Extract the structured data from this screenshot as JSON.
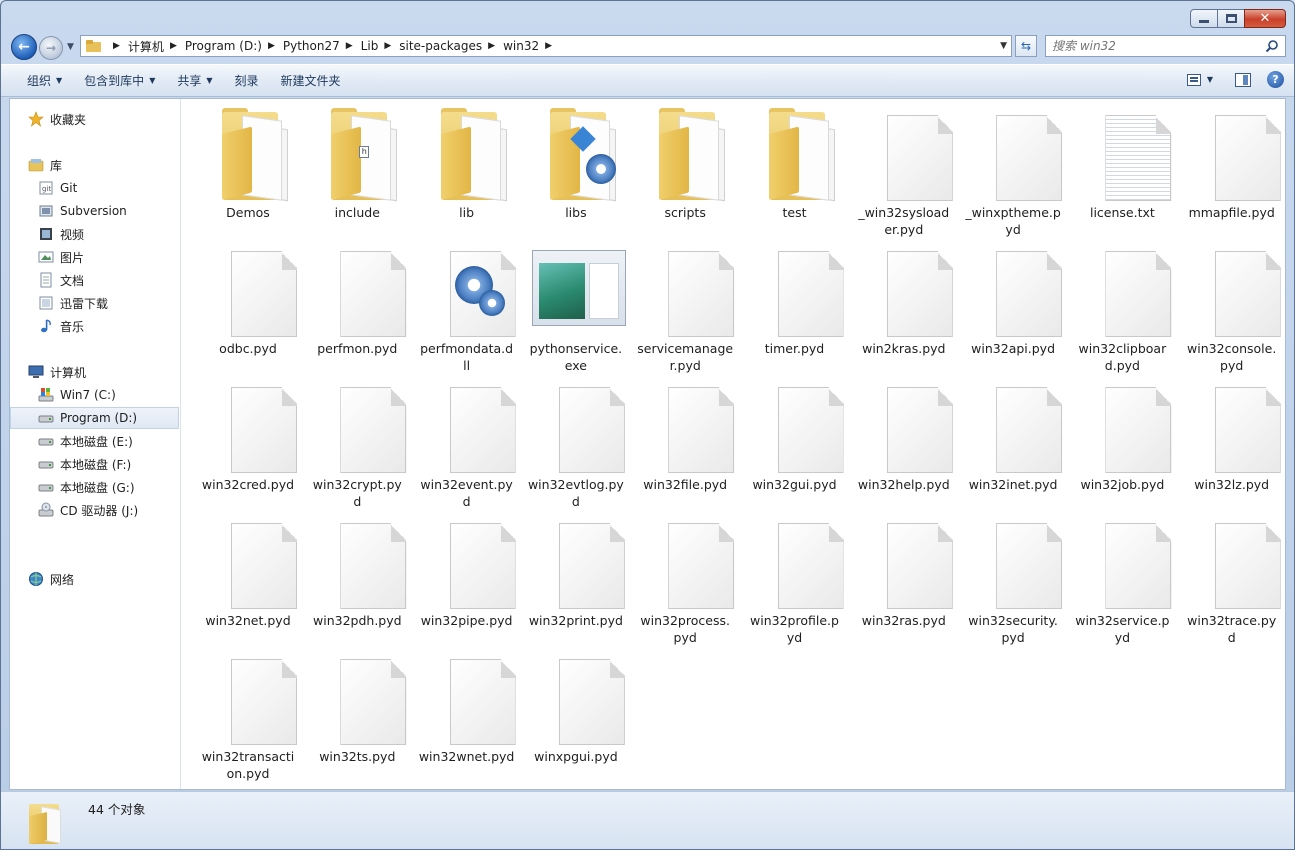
{
  "window": {
    "caption": {
      "minimize": "",
      "maximize": "",
      "close": "✕"
    }
  },
  "nav": {
    "breadcrumbs": [
      "计算机",
      "Program (D:)",
      "Python27",
      "Lib",
      "site-packages",
      "win32"
    ],
    "search_placeholder": "搜索 win32"
  },
  "toolbar": {
    "organize": "组织",
    "include_in_library": "包含到库中",
    "share": "共享",
    "burn": "刻录",
    "new_folder": "新建文件夹"
  },
  "sidebar": {
    "favorites": "收藏夹",
    "libraries": "库",
    "library_items": [
      "Git",
      "Subversion",
      "视频",
      "图片",
      "文档",
      "迅雷下载",
      "音乐"
    ],
    "computer": "计算机",
    "drives": [
      "Win7 (C:)",
      "Program (D:)",
      "本地磁盘 (E:)",
      "本地磁盘 (F:)",
      "本地磁盘 (G:)",
      "CD 驱动器 (J:)"
    ],
    "selected_drive": "Program (D:)",
    "network": "网络"
  },
  "files": [
    {
      "name": "Demos",
      "type": "folder"
    },
    {
      "name": "include",
      "type": "folder-h"
    },
    {
      "name": "lib",
      "type": "folder"
    },
    {
      "name": "libs",
      "type": "folder-gear"
    },
    {
      "name": "scripts",
      "type": "folder"
    },
    {
      "name": "test",
      "type": "folder"
    },
    {
      "name": "_win32sysloader.pyd",
      "type": "file"
    },
    {
      "name": "_winxptheme.pyd",
      "type": "file"
    },
    {
      "name": "license.txt",
      "type": "text"
    },
    {
      "name": "mmapfile.pyd",
      "type": "file"
    },
    {
      "name": "odbc.pyd",
      "type": "file"
    },
    {
      "name": "perfmon.pyd",
      "type": "file"
    },
    {
      "name": "perfmondata.dll",
      "type": "dll"
    },
    {
      "name": "pythonservice.exe",
      "type": "exe"
    },
    {
      "name": "servicemanager.pyd",
      "type": "file"
    },
    {
      "name": "timer.pyd",
      "type": "file"
    },
    {
      "name": "win2kras.pyd",
      "type": "file"
    },
    {
      "name": "win32api.pyd",
      "type": "file"
    },
    {
      "name": "win32clipboard.pyd",
      "type": "file"
    },
    {
      "name": "win32console.pyd",
      "type": "file"
    },
    {
      "name": "win32cred.pyd",
      "type": "file"
    },
    {
      "name": "win32crypt.pyd",
      "type": "file"
    },
    {
      "name": "win32event.pyd",
      "type": "file"
    },
    {
      "name": "win32evtlog.pyd",
      "type": "file"
    },
    {
      "name": "win32file.pyd",
      "type": "file"
    },
    {
      "name": "win32gui.pyd",
      "type": "file"
    },
    {
      "name": "win32help.pyd",
      "type": "file"
    },
    {
      "name": "win32inet.pyd",
      "type": "file"
    },
    {
      "name": "win32job.pyd",
      "type": "file"
    },
    {
      "name": "win32lz.pyd",
      "type": "file"
    },
    {
      "name": "win32net.pyd",
      "type": "file"
    },
    {
      "name": "win32pdh.pyd",
      "type": "file"
    },
    {
      "name": "win32pipe.pyd",
      "type": "file"
    },
    {
      "name": "win32print.pyd",
      "type": "file"
    },
    {
      "name": "win32process.pyd",
      "type": "file"
    },
    {
      "name": "win32profile.pyd",
      "type": "file"
    },
    {
      "name": "win32ras.pyd",
      "type": "file"
    },
    {
      "name": "win32security.pyd",
      "type": "file"
    },
    {
      "name": "win32service.pyd",
      "type": "file"
    },
    {
      "name": "win32trace.pyd",
      "type": "file"
    },
    {
      "name": "win32transaction.pyd",
      "type": "file"
    },
    {
      "name": "win32ts.pyd",
      "type": "file"
    },
    {
      "name": "win32wnet.pyd",
      "type": "file"
    },
    {
      "name": "winxpgui.pyd",
      "type": "file"
    }
  ],
  "status": {
    "count_text": "44 个对象"
  },
  "icons": {
    "back": "back-arrow-icon",
    "forward": "forward-arrow-icon",
    "refresh": "refresh-icon",
    "search": "search-icon",
    "help": "help-icon",
    "view": "view-options-icon",
    "preview_pane": "preview-pane-icon"
  },
  "colors": {
    "accent": "#1f5fb8",
    "selection": "#dfe8f4",
    "folder": "#e6bf55"
  }
}
